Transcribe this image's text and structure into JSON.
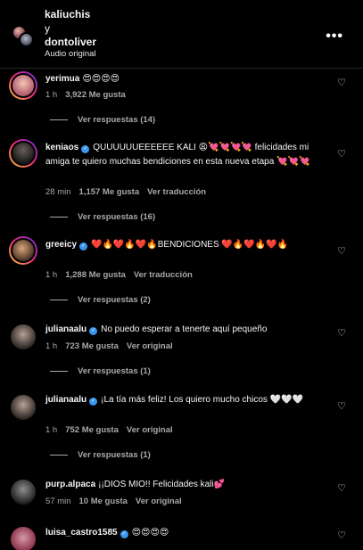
{
  "header": {
    "user1": "kaliuchis",
    "conjunction": "y",
    "user2": "dontoliver",
    "audio": "Audio original",
    "more_icon": "more-horizontal-icon"
  },
  "comments": [
    {
      "username": "yerimua",
      "verified": false,
      "text": "😍😍😍😍",
      "time": "1 h",
      "likes": "3,922 Me gusta",
      "action": "",
      "replies": "Ver respuestas (14)"
    },
    {
      "username": "keniaos",
      "verified": true,
      "text": "QUUUUUUEEEEEE KALI 😩💘💘💘💘 felicidades mi amiga te quiero muchas bendiciones en esta nueva etapa 💘💘💘",
      "time": "28 min",
      "likes": "1,157 Me gusta",
      "action": "Ver traducción",
      "replies": "Ver respuestas (16)"
    },
    {
      "username": "greeicy",
      "verified": true,
      "text": "❤️🔥❤️🔥❤️🔥BENDICIONES ❤️🔥❤️🔥❤️🔥",
      "time": "1 h",
      "likes": "1,288 Me gusta",
      "action": "Ver traducción",
      "replies": "Ver respuestas (2)"
    },
    {
      "username": "julianaalu",
      "verified": true,
      "text": "No puedo esperar a tenerte aquí pequeño",
      "time": "1 h",
      "likes": "723 Me gusta",
      "action": "Ver original",
      "replies": "Ver respuestas (1)"
    },
    {
      "username": "julianaalu",
      "verified": true,
      "text": "¡La tía más feliz! Los quiero mucho chicos 🤍🤍🤍",
      "time": "1 h",
      "likes": "752 Me gusta",
      "action": "Ver original",
      "replies": "Ver respuestas (1)"
    },
    {
      "username": "purp.alpaca",
      "verified": false,
      "text": "¡¡DIOS MIO!! Felicidades kali💕",
      "time": "57 min",
      "likes": "10 Me gusta",
      "action": "Ver original",
      "replies": ""
    },
    {
      "username": "luisa_castro1585",
      "verified": true,
      "text": "😍😍😍😍",
      "time": "",
      "likes": "",
      "action": "",
      "replies": ""
    }
  ],
  "icons": {
    "like": "heart-outline-icon",
    "verified": "verified-badge-icon"
  },
  "colors": {
    "background": "#000000",
    "secondary_text": "#a8a8a8",
    "verified": "#3897f0"
  }
}
